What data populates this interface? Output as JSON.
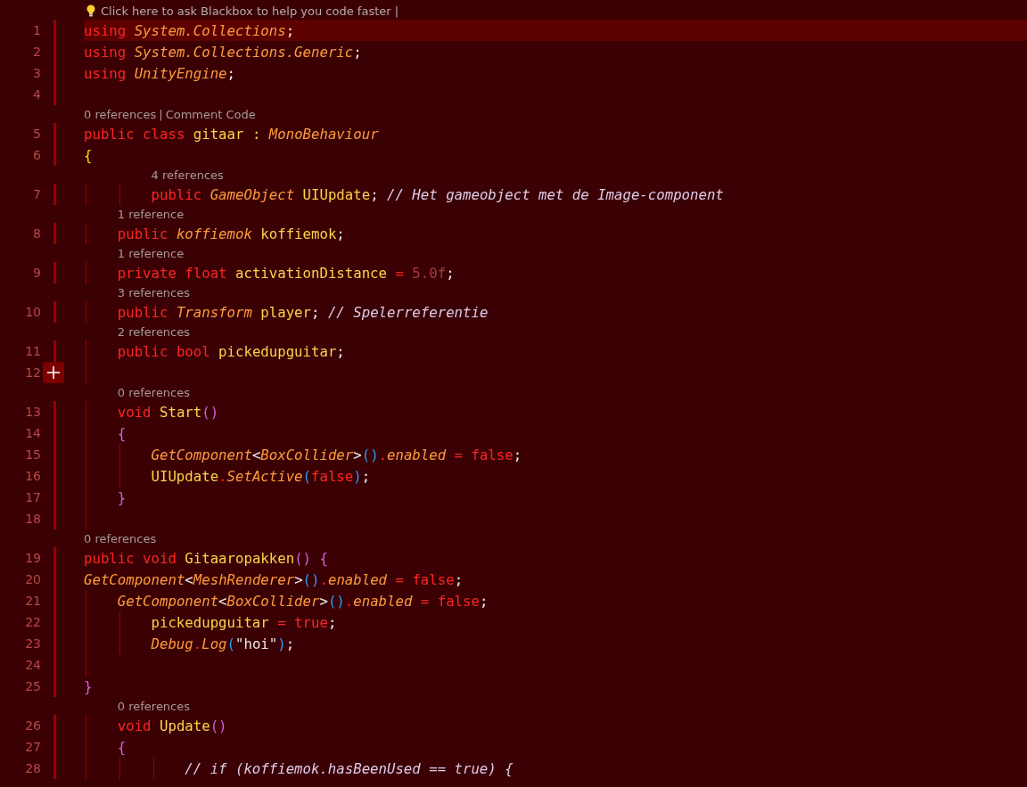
{
  "hint": {
    "text": "Click here to ask Blackbox to help you code faster |"
  },
  "lines": [
    {
      "number": "1",
      "current": true,
      "add_button": false,
      "tokens": [
        {
          "kind": "kw",
          "text": "using "
        },
        {
          "kind": "type",
          "text": "System.Collections"
        },
        {
          "kind": "punct",
          "text": ";"
        }
      ]
    },
    {
      "number": "2",
      "current": false,
      "add_button": false,
      "tokens": [
        {
          "kind": "kw",
          "text": "using "
        },
        {
          "kind": "type",
          "text": "System.Collections.Generic"
        },
        {
          "kind": "punct",
          "text": ";"
        }
      ]
    },
    {
      "number": "3",
      "current": false,
      "add_button": false,
      "tokens": [
        {
          "kind": "kw",
          "text": "using "
        },
        {
          "kind": "type",
          "text": "UnityEngine"
        },
        {
          "kind": "punct",
          "text": ";"
        }
      ]
    },
    {
      "number": "4",
      "current": false,
      "add_button": false
    },
    {
      "number": "5",
      "current": false,
      "add_button": false,
      "codelens": [
        "0 references",
        "|",
        "Comment Code"
      ],
      "tokens": [
        {
          "kind": "kw",
          "text": "public class "
        },
        {
          "kind": "id",
          "text": "gitaar : "
        },
        {
          "kind": "type",
          "text": "MonoBehaviour"
        }
      ]
    },
    {
      "number": "6",
      "current": false,
      "add_button": false,
      "tokens": [
        {
          "kind": "b1",
          "text": "{"
        }
      ]
    },
    {
      "number": "7",
      "current": false,
      "add_button": false,
      "codelens": [
        "4 references"
      ],
      "tokens": [
        {
          "kind": "indent"
        },
        {
          "kind": "indent"
        },
        {
          "kind": "kw",
          "text": "public "
        },
        {
          "kind": "type",
          "text": "GameObject "
        },
        {
          "kind": "id",
          "text": "UIUpdate"
        },
        {
          "kind": "punct",
          "text": "; "
        },
        {
          "kind": "comment",
          "text": "// Het gameobject met de Image-component"
        }
      ]
    },
    {
      "number": "8",
      "current": false,
      "add_button": false,
      "codelens": [
        "1 reference"
      ],
      "tokens": [
        {
          "kind": "indent"
        },
        {
          "kind": "kw",
          "text": "public "
        },
        {
          "kind": "type",
          "text": "koffiemok "
        },
        {
          "kind": "id",
          "text": "koffiemok"
        },
        {
          "kind": "punct",
          "text": ";"
        }
      ]
    },
    {
      "number": "9",
      "current": false,
      "add_button": false,
      "codelens": [
        "1 reference"
      ],
      "tokens": [
        {
          "kind": "indent"
        },
        {
          "kind": "kw",
          "text": "private float "
        },
        {
          "kind": "id",
          "text": "activationDistance "
        },
        {
          "kind": "op",
          "text": "= "
        },
        {
          "kind": "num",
          "text": "5.0f"
        },
        {
          "kind": "punct",
          "text": ";"
        }
      ]
    },
    {
      "number": "10",
      "current": false,
      "add_button": false,
      "codelens": [
        "3 references"
      ],
      "tokens": [
        {
          "kind": "indent"
        },
        {
          "kind": "kw",
          "text": "public "
        },
        {
          "kind": "type",
          "text": "Transform "
        },
        {
          "kind": "id",
          "text": "player"
        },
        {
          "kind": "punct",
          "text": "; "
        },
        {
          "kind": "comment",
          "text": "// Spelerreferentie"
        }
      ]
    },
    {
      "number": "11",
      "current": false,
      "add_button": false,
      "codelens": [
        "2 references"
      ],
      "tokens": [
        {
          "kind": "indent"
        },
        {
          "kind": "kw",
          "text": "public bool "
        },
        {
          "kind": "id",
          "text": "pickedupguitar"
        },
        {
          "kind": "punct",
          "text": ";"
        }
      ]
    },
    {
      "number": "12",
      "current": false,
      "add_button": true,
      "tokens": [
        {
          "kind": "indent"
        }
      ]
    },
    {
      "number": "13",
      "current": false,
      "add_button": false,
      "codelens": [
        "0 references"
      ],
      "tokens": [
        {
          "kind": "indent"
        },
        {
          "kind": "kw",
          "text": "void "
        },
        {
          "kind": "id",
          "text": "Start"
        },
        {
          "kind": "b2",
          "text": "()"
        }
      ]
    },
    {
      "number": "14",
      "current": false,
      "add_button": false,
      "tokens": [
        {
          "kind": "indent"
        },
        {
          "kind": "b2",
          "text": "{"
        }
      ]
    },
    {
      "number": "15",
      "current": false,
      "add_button": false,
      "tokens": [
        {
          "kind": "indent"
        },
        {
          "kind": "indent"
        },
        {
          "kind": "type",
          "text": "GetComponent"
        },
        {
          "kind": "punct",
          "text": "<"
        },
        {
          "kind": "type",
          "text": "BoxCollider"
        },
        {
          "kind": "punct",
          "text": ">"
        },
        {
          "kind": "b3",
          "text": "()"
        },
        {
          "kind": "op",
          "text": "."
        },
        {
          "kind": "type",
          "text": "enabled "
        },
        {
          "kind": "op",
          "text": "= "
        },
        {
          "kind": "kw",
          "text": "false"
        },
        {
          "kind": "punct",
          "text": ";"
        }
      ]
    },
    {
      "number": "16",
      "current": false,
      "add_button": false,
      "tokens": [
        {
          "kind": "indent"
        },
        {
          "kind": "indent"
        },
        {
          "kind": "id",
          "text": "UIUpdate"
        },
        {
          "kind": "op",
          "text": "."
        },
        {
          "kind": "type",
          "text": "SetActive"
        },
        {
          "kind": "b3",
          "text": "("
        },
        {
          "kind": "kw",
          "text": "false"
        },
        {
          "kind": "b3",
          "text": ")"
        },
        {
          "kind": "punct",
          "text": ";"
        }
      ]
    },
    {
      "number": "17",
      "current": false,
      "add_button": false,
      "tokens": [
        {
          "kind": "indent"
        },
        {
          "kind": "b2",
          "text": "}"
        }
      ]
    },
    {
      "number": "18",
      "current": false,
      "add_button": false,
      "tokens": [
        {
          "kind": "indent"
        }
      ]
    },
    {
      "number": "19",
      "current": false,
      "add_button": false,
      "codelens": [
        "0 references"
      ],
      "tokens": [
        {
          "kind": "kw",
          "text": "public void "
        },
        {
          "kind": "id",
          "text": "Gitaaropakken"
        },
        {
          "kind": "b2",
          "text": "() {"
        }
      ]
    },
    {
      "number": "20",
      "current": false,
      "add_button": false,
      "tokens": [
        {
          "kind": "type",
          "text": "GetComponent"
        },
        {
          "kind": "punct",
          "text": "<"
        },
        {
          "kind": "type",
          "text": "MeshRenderer"
        },
        {
          "kind": "punct",
          "text": ">"
        },
        {
          "kind": "b3",
          "text": "()"
        },
        {
          "kind": "op",
          "text": "."
        },
        {
          "kind": "type",
          "text": "enabled "
        },
        {
          "kind": "op",
          "text": "= "
        },
        {
          "kind": "kw",
          "text": "false"
        },
        {
          "kind": "punct",
          "text": ";"
        }
      ]
    },
    {
      "number": "21",
      "current": false,
      "add_button": false,
      "tokens": [
        {
          "kind": "indent"
        },
        {
          "kind": "type",
          "text": "GetComponent"
        },
        {
          "kind": "punct",
          "text": "<"
        },
        {
          "kind": "type",
          "text": "BoxCollider"
        },
        {
          "kind": "punct",
          "text": ">"
        },
        {
          "kind": "b3",
          "text": "()"
        },
        {
          "kind": "op",
          "text": "."
        },
        {
          "kind": "type",
          "text": "enabled "
        },
        {
          "kind": "op",
          "text": "= "
        },
        {
          "kind": "kw",
          "text": "false"
        },
        {
          "kind": "punct",
          "text": ";"
        }
      ]
    },
    {
      "number": "22",
      "current": false,
      "add_button": false,
      "tokens": [
        {
          "kind": "indent"
        },
        {
          "kind": "indent"
        },
        {
          "kind": "id",
          "text": "pickedupguitar "
        },
        {
          "kind": "op",
          "text": "= "
        },
        {
          "kind": "kw",
          "text": "true"
        },
        {
          "kind": "punct",
          "text": ";"
        }
      ]
    },
    {
      "number": "23",
      "current": false,
      "add_button": false,
      "tokens": [
        {
          "kind": "indent"
        },
        {
          "kind": "indent"
        },
        {
          "kind": "type",
          "text": "Debug"
        },
        {
          "kind": "op",
          "text": "."
        },
        {
          "kind": "type",
          "text": "Log"
        },
        {
          "kind": "b3",
          "text": "("
        },
        {
          "kind": "str",
          "text": "\"hoi\""
        },
        {
          "kind": "b3",
          "text": ")"
        },
        {
          "kind": "punct",
          "text": ";"
        }
      ]
    },
    {
      "number": "24",
      "current": false,
      "add_button": false,
      "tokens": [
        {
          "kind": "indent"
        }
      ]
    },
    {
      "number": "25",
      "current": false,
      "add_button": false,
      "tokens": [
        {
          "kind": "b2",
          "text": "}"
        }
      ]
    },
    {
      "number": "26",
      "current": false,
      "add_button": false,
      "codelens": [
        "0 references"
      ],
      "tokens": [
        {
          "kind": "indent"
        },
        {
          "kind": "kw",
          "text": "void "
        },
        {
          "kind": "id",
          "text": "Update"
        },
        {
          "kind": "b2",
          "text": "()"
        }
      ]
    },
    {
      "number": "27",
      "current": false,
      "add_button": false,
      "tokens": [
        {
          "kind": "indent"
        },
        {
          "kind": "b2",
          "text": "{"
        }
      ]
    },
    {
      "number": "28",
      "current": false,
      "add_button": false,
      "tokens": [
        {
          "kind": "indent"
        },
        {
          "kind": "indent"
        },
        {
          "kind": "indent"
        },
        {
          "kind": "comment",
          "text": "// if (koffiemok.hasBeenUsed == true) {"
        }
      ]
    }
  ]
}
